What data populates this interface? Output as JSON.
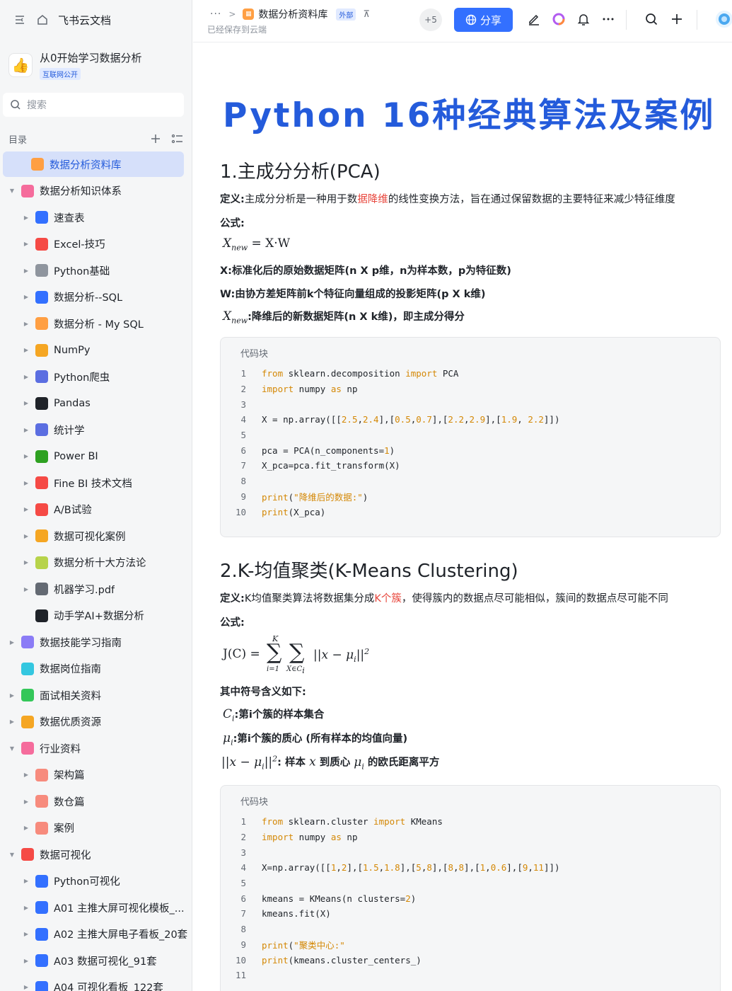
{
  "sidebar": {
    "brand": "飞书云文档",
    "space_title": "从0开始学习数据分析",
    "space_tag": "互联网公开",
    "search_placeholder": "搜索",
    "toc_label": "目录",
    "items": [
      {
        "label": "数据分析资料库",
        "level": 0,
        "active": true,
        "arrow": "",
        "color": "#ff9f43"
      },
      {
        "label": "数据分析知识体系",
        "level": 0,
        "arrow": "▼",
        "color": "#f56c9c"
      },
      {
        "label": "速查表",
        "level": 1,
        "arrow": "▶",
        "color": "#3370ff"
      },
      {
        "label": "Excel-技巧",
        "level": 1,
        "arrow": "▶",
        "color": "#f54a45"
      },
      {
        "label": "Python基础",
        "level": 1,
        "arrow": "▶",
        "color": "#8f959e"
      },
      {
        "label": "数据分析--SQL",
        "level": 1,
        "arrow": "▶",
        "color": "#3370ff"
      },
      {
        "label": "数据分析 - My SQL",
        "level": 1,
        "arrow": "▶",
        "color": "#ff9f43"
      },
      {
        "label": "NumPy",
        "level": 1,
        "arrow": "▶",
        "color": "#f5a623"
      },
      {
        "label": "Python爬虫",
        "level": 1,
        "arrow": "▶",
        "color": "#5b6ee1"
      },
      {
        "label": "Pandas",
        "level": 1,
        "arrow": "▶",
        "color": "#1f2329"
      },
      {
        "label": "统计学",
        "level": 1,
        "arrow": "▶",
        "color": "#5b6ee1"
      },
      {
        "label": "Power BI",
        "level": 1,
        "arrow": "▶",
        "color": "#2ea121"
      },
      {
        "label": "Fine BI 技术文档",
        "level": 1,
        "arrow": "▶",
        "color": "#f54a45"
      },
      {
        "label": "A/B试验",
        "level": 1,
        "arrow": "▶",
        "color": "#f54a45"
      },
      {
        "label": "数据可视化案例",
        "level": 1,
        "arrow": "▶",
        "color": "#f5a623"
      },
      {
        "label": "数据分析十大方法论",
        "level": 1,
        "arrow": "▶",
        "color": "#b7d34a"
      },
      {
        "label": "机器学习.pdf",
        "level": 1,
        "arrow": "▶",
        "color": "#646a73"
      },
      {
        "label": "动手学AI+数据分析",
        "level": 1,
        "arrow": "",
        "color": "#1f2329"
      },
      {
        "label": "数据技能学习指南",
        "level": 0,
        "arrow": "▶",
        "color": "#8b7cf6"
      },
      {
        "label": "数据岗位指南",
        "level": 0,
        "arrow": "",
        "color": "#34c7e0"
      },
      {
        "label": "面试相关资料",
        "level": 0,
        "arrow": "▶",
        "color": "#34c759"
      },
      {
        "label": "数据优质资源",
        "level": 0,
        "arrow": "▶",
        "color": "#f5a623"
      },
      {
        "label": "行业资料",
        "level": 0,
        "arrow": "▼",
        "color": "#f56c9c"
      },
      {
        "label": "架构篇",
        "level": 1,
        "arrow": "▶",
        "color": "#f78b7d"
      },
      {
        "label": "数仓篇",
        "level": 1,
        "arrow": "▶",
        "color": "#f78b7d"
      },
      {
        "label": "案例",
        "level": 1,
        "arrow": "▶",
        "color": "#f78b7d"
      },
      {
        "label": "数据可视化",
        "level": 0,
        "arrow": "▼",
        "color": "#f54a45"
      },
      {
        "label": "Python可视化",
        "level": 1,
        "arrow": "▶",
        "color": "#3370ff"
      },
      {
        "label": "A01 主推大屏可视化模板_...",
        "level": 1,
        "arrow": "▶",
        "color": "#3370ff"
      },
      {
        "label": "A02 主推大屏电子看板_20套",
        "level": 1,
        "arrow": "▶",
        "color": "#3370ff"
      },
      {
        "label": "A03 数据可视化_91套",
        "level": 1,
        "arrow": "▶",
        "color": "#3370ff"
      },
      {
        "label": "A04 可视化看板_122套",
        "level": 1,
        "arrow": "▶",
        "color": "#3370ff"
      }
    ]
  },
  "topbar": {
    "dots": "···",
    "crumb": "数据分析资料库",
    "external_tag": "外部",
    "saved_text": "已经保存到云端",
    "collaborators": "+5",
    "share_label": "分享"
  },
  "doc": {
    "title": "Python 16种经典算法及案例",
    "s1": {
      "heading": "1.主成分分析(PCA)",
      "def_label": "定义:",
      "def_text_a": "主成分分析是一种用于数",
      "def_text_red": "据降维",
      "def_text_b": "的线性变换方法，旨在通过保留数据的主要特征来减少特征维度",
      "formula_label": "公式:",
      "eq_x": "X",
      "eq_sub": "new",
      "eq_rhs": " = X·W",
      "x_desc": "X:标准化后的原始数据矩阵(n X p维，n为样本数，p为特征数)",
      "w_desc": "W:由协方差矩阵前k个特征向量组成的投影矩阵(p X k维)",
      "xnew_desc": ":降维后的新数据矩阵(n X k维)，即主成分得分",
      "code_title": "代码块",
      "code": [
        "from sklearn.decomposition import PCA",
        "import numpy as np",
        "",
        "X = np.array([[2.5,2.4],[0.5,0.7],[2.2,2.9],[1.9, 2.2]])",
        "",
        "pca = PCA(n_components=1)",
        "X_pca=pca.fit_transform(X)",
        "",
        "print(\"降维后的数据:\")",
        "print(X_pca)"
      ]
    },
    "s2": {
      "heading": "2.K-均值聚类(K-Means Clustering)",
      "def_label": "定义:",
      "def_text_a": "K均值聚类算法将数据集分成",
      "def_text_red": "K个簇",
      "def_text_b": "，使得簇内的数据点尽可能相似，簇间的数据点尽可能不同",
      "formula_label": "公式:",
      "eq_lhs": "J(C) = ",
      "eq_top": "K",
      "eq_bot1": "i=1",
      "eq_bot2": "X∈C",
      "eq_bot2_sub": "i",
      "eq_body": "||x − μ",
      "eq_body_sub": "i",
      "eq_body_end": "||",
      "eq_sup": "2",
      "symbols_label": "其中符号含义如下:",
      "ci_sym": "C",
      "ci_sub": "i",
      "ci_desc": ":第i个簇的样本集合",
      "mu_sym": "μ",
      "mu_sub": "i",
      "mu_desc": ":第i个簇的质心 (所有样本的均值向量)",
      "dist_sym": "||x − μ",
      "dist_sub": "i",
      "dist_end": "||",
      "dist_sup": "2",
      "dist_desc_a": ": 样本 ",
      "dist_x": "x",
      "dist_desc_b": " 到质心 ",
      "dist_mu": "μ",
      "dist_mu_sub": "i",
      "dist_desc_c": " 的欧氏距离平方",
      "code_title": "代码块",
      "code": [
        "from sklearn.cluster import KMeans",
        "import numpy as np",
        "",
        "X=np.array([[1,2],[1.5,1.8],[5,8],[8,8],[1,0.6],[9,11]])",
        "",
        "kmeans = KMeans(n clusters=2)",
        "kmeans.fit(X)",
        "",
        "print(\"聚类中心:\"",
        "print(kmeans.cluster_centers_)",
        ""
      ]
    }
  }
}
